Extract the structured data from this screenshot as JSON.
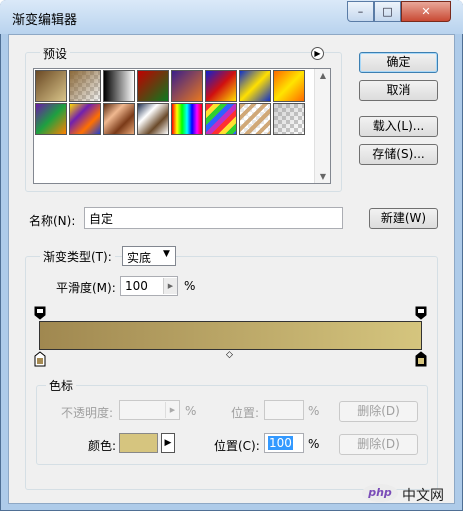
{
  "window": {
    "title": "渐变编辑器"
  },
  "caption_buttons": {
    "minimize": "–",
    "maximize": "□",
    "close": "✕"
  },
  "presets": {
    "label": "预设",
    "swatches": [
      {
        "name": "foreground-to-background",
        "css": "linear-gradient(135deg,#6b4a25,#d9c48a)"
      },
      {
        "name": "foreground-to-transparent",
        "css": "linear-gradient(135deg,#8c6a3a,rgba(200,200,200,0.2))",
        "checker": true
      },
      {
        "name": "black-white",
        "css": "linear-gradient(90deg,#000,#fff)"
      },
      {
        "name": "red-green",
        "css": "linear-gradient(135deg,#c00000,#0a7a1e)"
      },
      {
        "name": "violet-orange",
        "css": "linear-gradient(135deg,#3a1f8a,#e9781f)"
      },
      {
        "name": "blue-red-yellow",
        "css": "linear-gradient(135deg,#1020d0,#d01010,#ffe000)"
      },
      {
        "name": "blue-yellow-blue",
        "css": "linear-gradient(135deg,#1030c8,#ffe000,#1030c8)"
      },
      {
        "name": "orange-yellow-orange",
        "css": "linear-gradient(135deg,#ff6a00,#ffe400,#ff6a00)"
      },
      {
        "name": "violet-green-orange",
        "css": "linear-gradient(135deg,#6a1aa8,#1ea040,#ff8000)"
      },
      {
        "name": "yellow-violet-orange-blue",
        "css": "linear-gradient(135deg,#ffd800,#7020b0,#ff7000,#2040d0)"
      },
      {
        "name": "copper",
        "css": "linear-gradient(135deg,#5a2a10,#f0b890,#7a3a18,#e8a878)"
      },
      {
        "name": "chrome",
        "css": "linear-gradient(135deg,#203050,#ffffff,#6a4a2a,#ffffff)"
      },
      {
        "name": "spectrum",
        "css": "linear-gradient(90deg,#ff0000,#ffff00,#00ff00,#00ffff,#0000ff,#ff00ff,#ff0000)"
      },
      {
        "name": "transparent-rainbow",
        "css": "repeating-linear-gradient(135deg,#ff3030 0 5px,#ffe030 5px 10px,#30d030 10px 15px,#3060ff 15px 20px,#c030c0 20px 25px)"
      },
      {
        "name": "transparent-stripes",
        "css": "repeating-linear-gradient(135deg,#d0a878 0 4px,rgba(255,255,255,0.6) 4px 8px)",
        "checker": true
      },
      {
        "name": "neutral-density",
        "css": "linear-gradient(135deg,rgba(160,160,160,0.5),rgba(255,255,255,0))",
        "checker": true
      }
    ]
  },
  "buttons": {
    "ok": "确定",
    "cancel": "取消",
    "load": "载入(L)...",
    "save": "存储(S)...",
    "new": "新建(W)",
    "delete_opacity": "删除(D)",
    "delete_color": "删除(D)"
  },
  "name": {
    "label": "名称(N):",
    "value": "自定"
  },
  "gradient": {
    "type_label": "渐变类型(T):",
    "type_value": "实底",
    "smoothness_label": "平滑度(M):",
    "smoothness_value": "100",
    "percent": "%",
    "start_color": "#a08850",
    "end_color": "#d5c57e",
    "stop_color_start": "#a58a52",
    "stop_color_end": "#d6c57f"
  },
  "stops": {
    "label": "色标",
    "opacity_label": "不透明度:",
    "opacity_value": "",
    "opacity_percent": "%",
    "opacity_location_label": "位置:",
    "opacity_location_value": "",
    "opacity_location_percent": "%",
    "color_label": "颜色:",
    "color_swatch": "#d6c57f",
    "color_location_label": "位置(C):",
    "color_location_value": "100",
    "color_location_percent": "%"
  },
  "watermark": {
    "text": "中文网",
    "brand": "php"
  }
}
